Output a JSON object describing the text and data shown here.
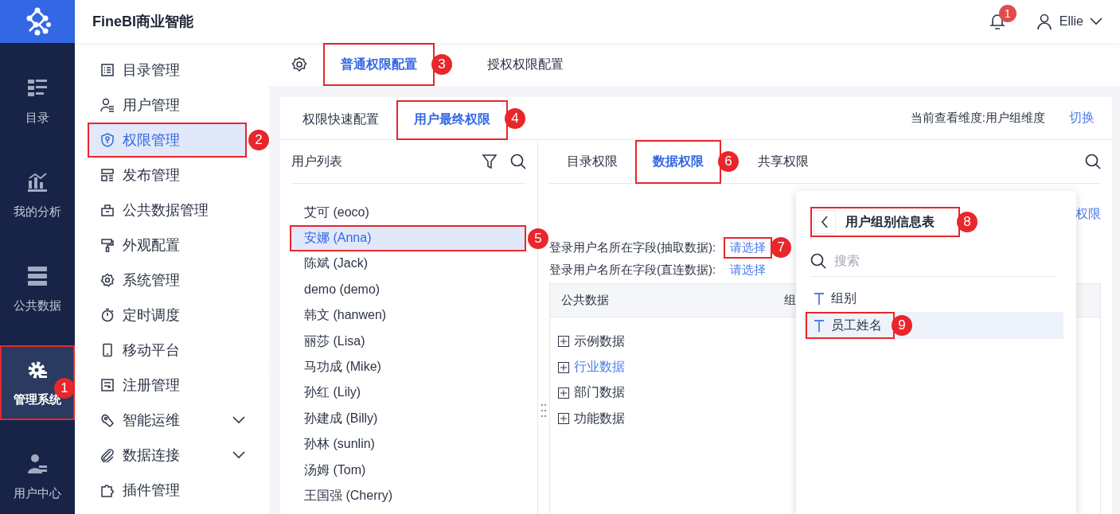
{
  "app": {
    "title": "FineBI商业智能"
  },
  "header": {
    "notifications": "1",
    "user": "Ellie"
  },
  "rail": [
    {
      "label": "目录",
      "selected": false
    },
    {
      "label": "我的分析",
      "selected": false
    },
    {
      "label": "公共数据",
      "selected": false
    },
    {
      "label": "管理系统",
      "selected": true,
      "callout": "1"
    },
    {
      "label": "用户中心",
      "selected": false
    }
  ],
  "menu": [
    {
      "label": "目录管理",
      "kind": "link",
      "selected": false
    },
    {
      "label": "用户管理",
      "kind": "link",
      "selected": false
    },
    {
      "label": "权限管理",
      "kind": "link",
      "selected": true,
      "callout": "2"
    },
    {
      "label": "发布管理",
      "kind": "link",
      "selected": false
    },
    {
      "label": "公共数据管理",
      "kind": "link",
      "selected": false
    },
    {
      "label": "外观配置",
      "kind": "link",
      "selected": false
    },
    {
      "label": "系统管理",
      "kind": "link",
      "selected": false
    },
    {
      "label": "定时调度",
      "kind": "link",
      "selected": false
    },
    {
      "label": "移动平台",
      "kind": "link",
      "selected": false
    },
    {
      "label": "注册管理",
      "kind": "link",
      "selected": false
    },
    {
      "label": "智能运维",
      "kind": "group",
      "selected": false
    },
    {
      "label": "数据连接",
      "kind": "group",
      "selected": false
    },
    {
      "label": "插件管理",
      "kind": "link",
      "selected": false
    }
  ],
  "top_tabs": [
    {
      "label": "普通权限配置",
      "selected": true,
      "callout": "3"
    },
    {
      "label": "授权权限配置",
      "selected": false
    }
  ],
  "view_tabs": [
    {
      "label": "权限快速配置",
      "selected": false
    },
    {
      "label": "用户最终权限",
      "selected": true,
      "callout": "4"
    }
  ],
  "view_info": {
    "text": "当前查看维度:用户组维度",
    "switch": "切换"
  },
  "user_list": {
    "title": "用户列表",
    "users": [
      {
        "name": "艾可 (eoco)",
        "selected": false
      },
      {
        "name": "安娜 (Anna)",
        "selected": true,
        "callout": "5"
      },
      {
        "name": "陈斌 (Jack)",
        "selected": false
      },
      {
        "name": "demo (demo)",
        "selected": false
      },
      {
        "name": "韩文 (hanwen)",
        "selected": false
      },
      {
        "name": "丽莎 (Lisa)",
        "selected": false
      },
      {
        "name": "马功成 (Mike)",
        "selected": false
      },
      {
        "name": "孙红 (Lily)",
        "selected": false
      },
      {
        "name": "孙建成 (Billy)",
        "selected": false
      },
      {
        "name": "孙林 (sunlin)",
        "selected": false
      },
      {
        "name": "汤姆 (Tom)",
        "selected": false
      },
      {
        "name": "王国强 (Cherry)",
        "selected": false
      }
    ]
  },
  "perm_tabs": [
    {
      "label": "目录权限",
      "selected": false
    },
    {
      "label": "数据权限",
      "selected": true,
      "callout": "6"
    },
    {
      "label": "共享权限",
      "selected": false
    }
  ],
  "perm_link": "权限",
  "fields": [
    {
      "label": "登录用户名所在字段(抽取数据):",
      "value": "请选择",
      "callout": "7"
    },
    {
      "label": "登录用户名所在字段(直连数据):",
      "value": "请选择"
    }
  ],
  "table": {
    "columns": [
      "公共数据",
      "组"
    ],
    "rows": [
      {
        "label": "示例数据",
        "selected": false
      },
      {
        "label": "行业数据",
        "selected": true
      },
      {
        "label": "部门数据",
        "selected": false
      },
      {
        "label": "功能数据",
        "selected": false
      }
    ]
  },
  "popup": {
    "title": "用户组别信息表",
    "callout": "8",
    "placeholder": "搜索",
    "fields": [
      {
        "label": "组别",
        "selected": false
      },
      {
        "label": "员工姓名",
        "selected": true,
        "callout": "9"
      }
    ]
  }
}
